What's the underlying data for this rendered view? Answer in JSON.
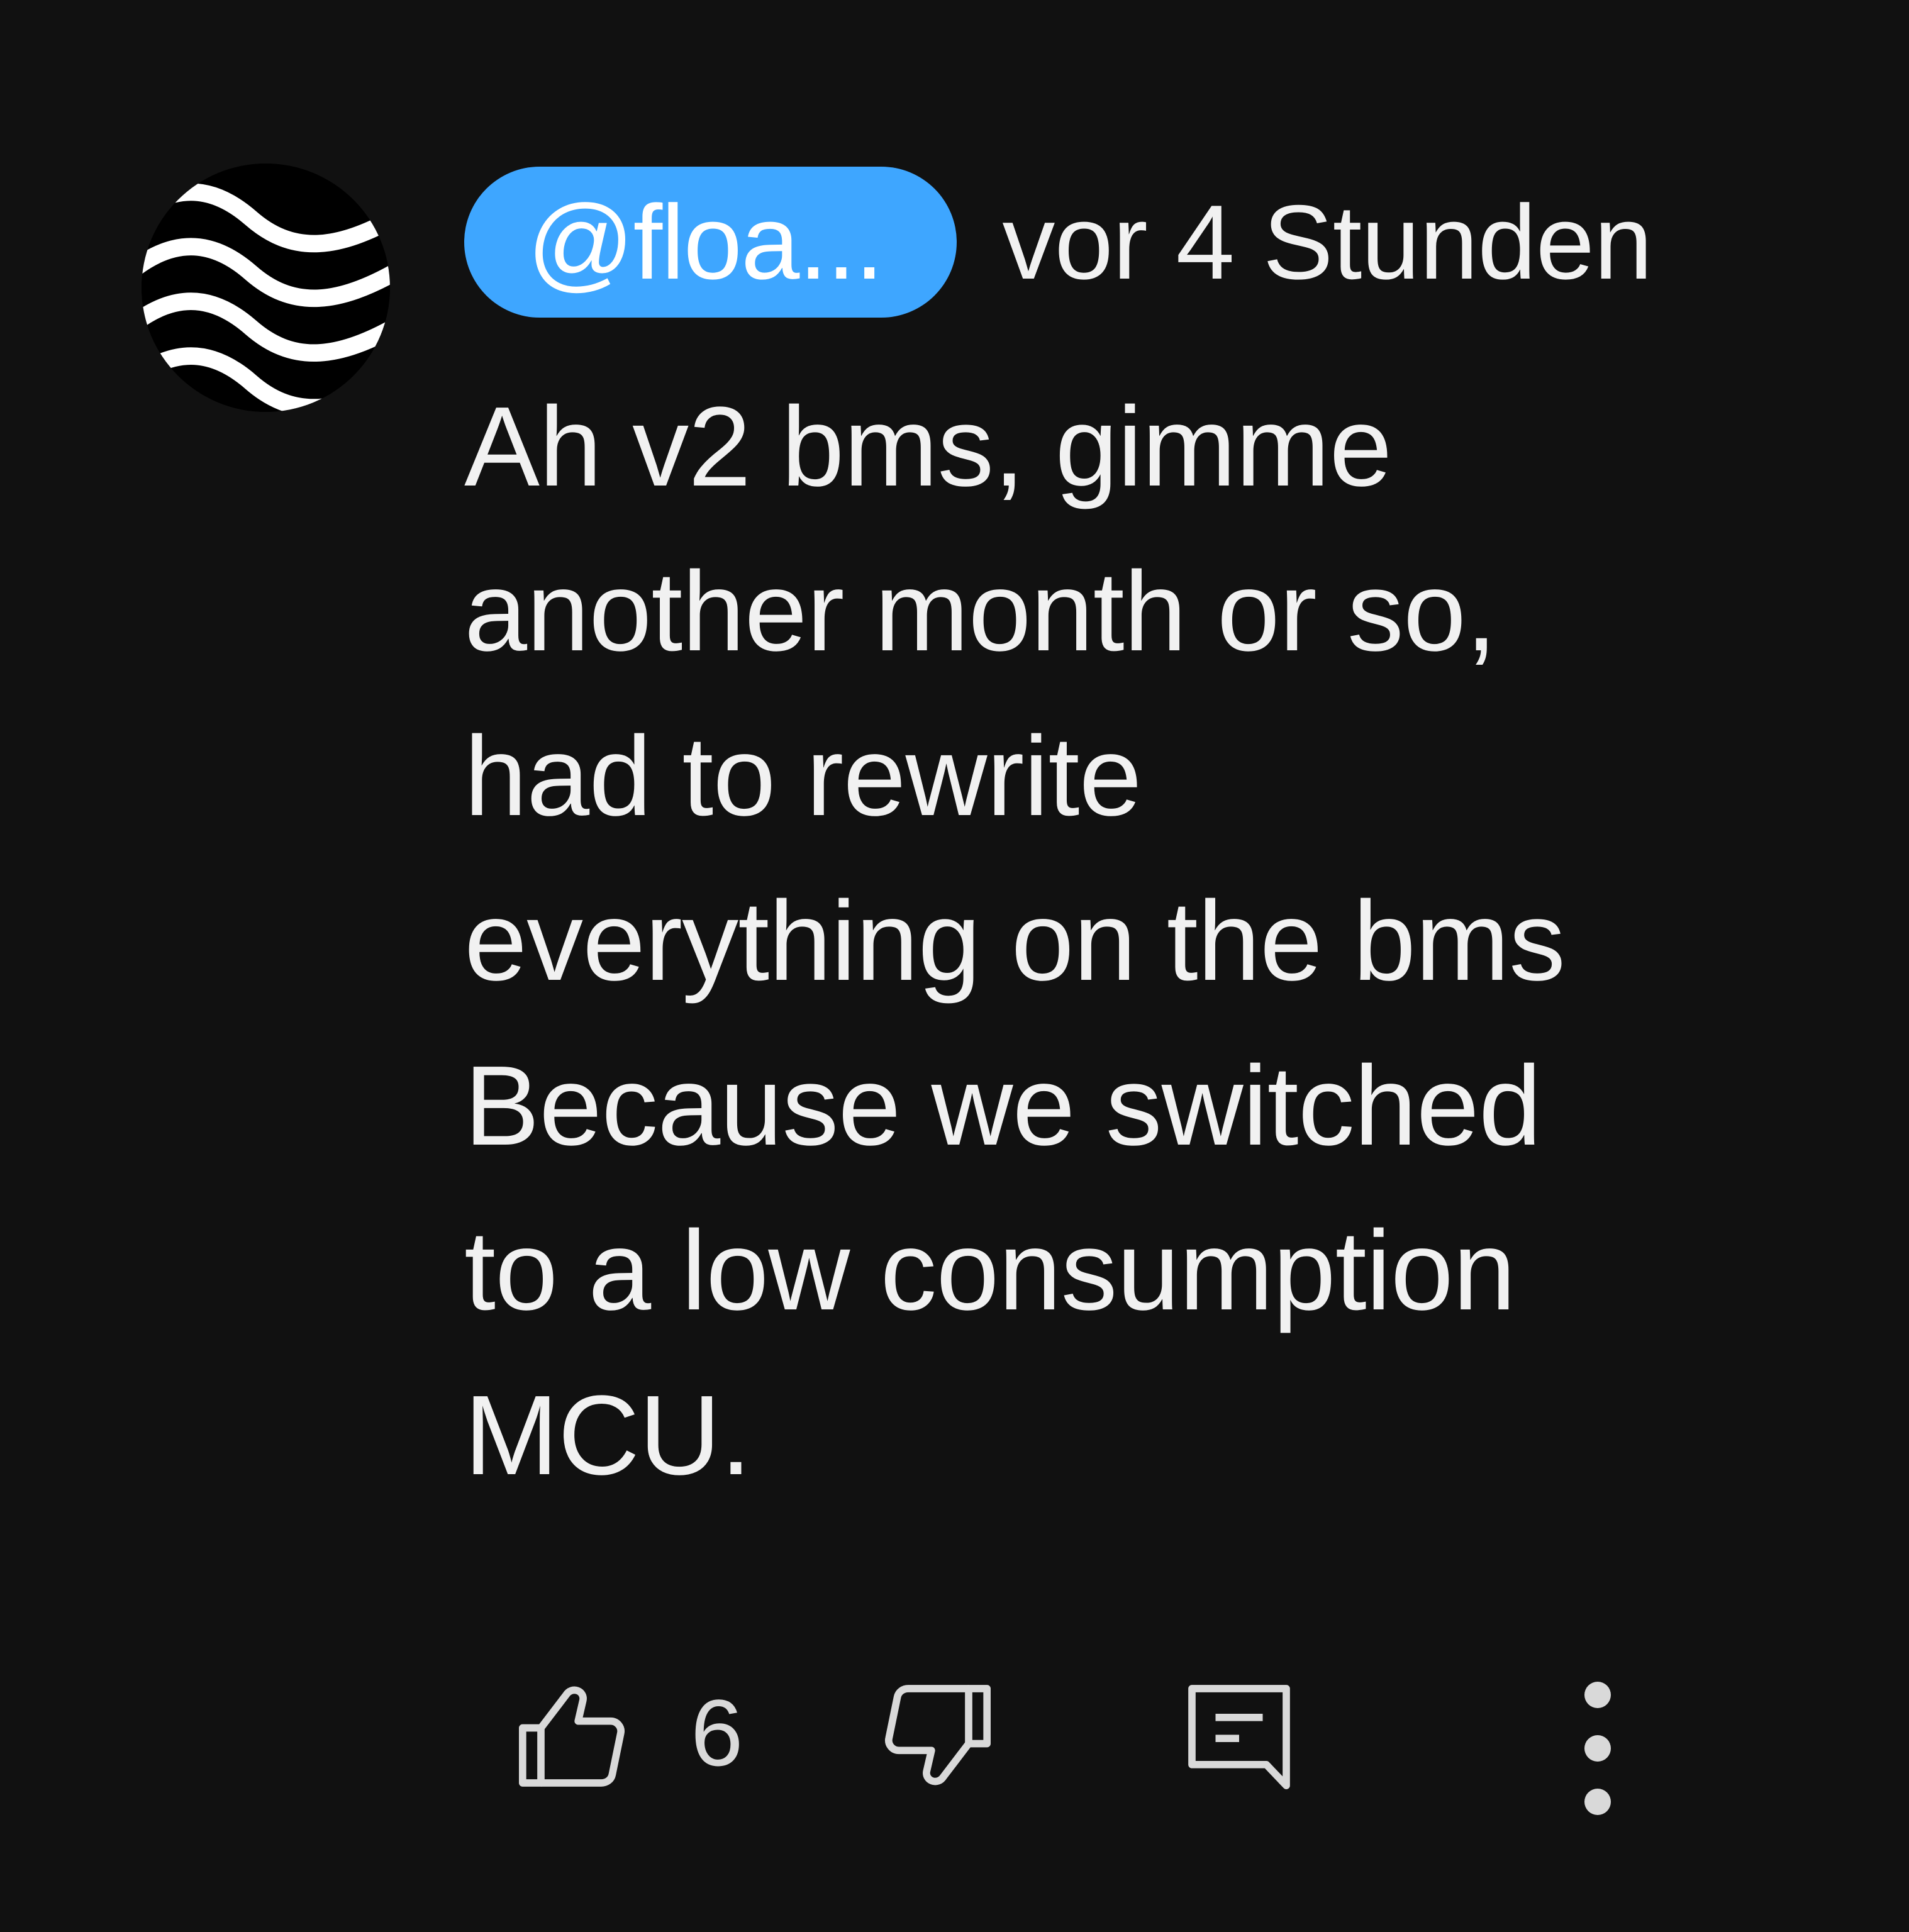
{
  "comment": {
    "author_handle": "@floa...",
    "timestamp": "vor 4 Stunden",
    "text": "Ah v2 bms, gimme\nanother month or so,\nhad to rewrite\neverything on the bms\nBecause we switched\nto a low consumption\nMCU."
  },
  "actions": {
    "like_count": "6",
    "like_icon": "thumbs-up-icon",
    "dislike_icon": "thumbs-down-icon",
    "reply_icon": "comment-reply-icon",
    "more_icon": "more-vertical-icon"
  },
  "colors": {
    "background": "#111111",
    "handle_badge": "#3ea6ff",
    "text": "#f1f1f1",
    "icon": "#d9d9d9"
  }
}
